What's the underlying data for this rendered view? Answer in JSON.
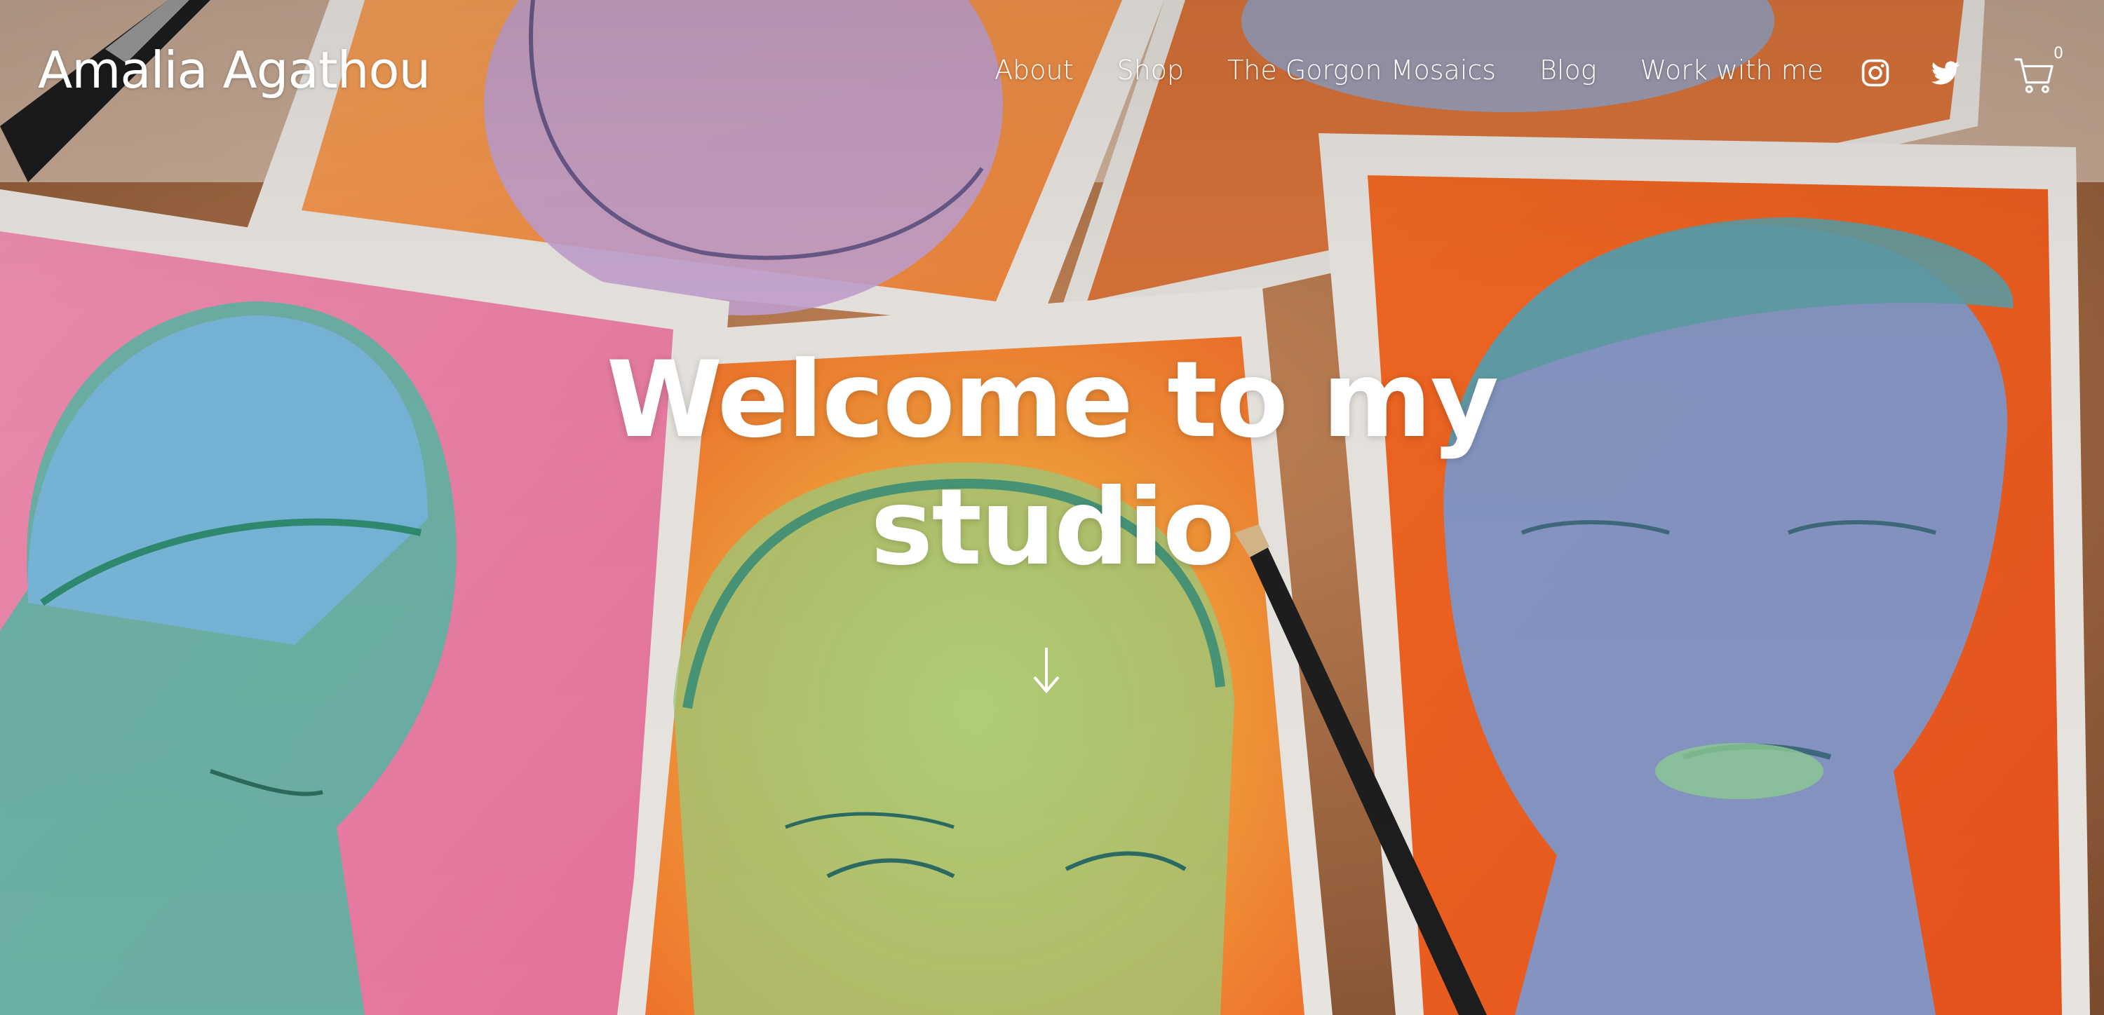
{
  "site": {
    "title": "Amalia Agathou"
  },
  "nav": {
    "items": [
      {
        "label": "About"
      },
      {
        "label": "Shop"
      },
      {
        "label": "The Gorgon Mosaics"
      },
      {
        "label": "Blog"
      },
      {
        "label": "Work with me"
      }
    ]
  },
  "social": {
    "icons": [
      "instagram-icon",
      "twitter-icon"
    ]
  },
  "cart": {
    "icon": "cart-icon",
    "count": "0"
  },
  "hero": {
    "title_line1": "Welcome to my",
    "title_line2": "studio",
    "scroll_icon": "arrow-down-icon",
    "background": "watercolor-portraits-photo"
  },
  "colors": {
    "text": "#ffffff",
    "paper": "#ece7e1",
    "orange": "#f07a2a",
    "pink": "#f29ab8",
    "teal": "#4ea79c",
    "blue": "#6f8fcf"
  }
}
